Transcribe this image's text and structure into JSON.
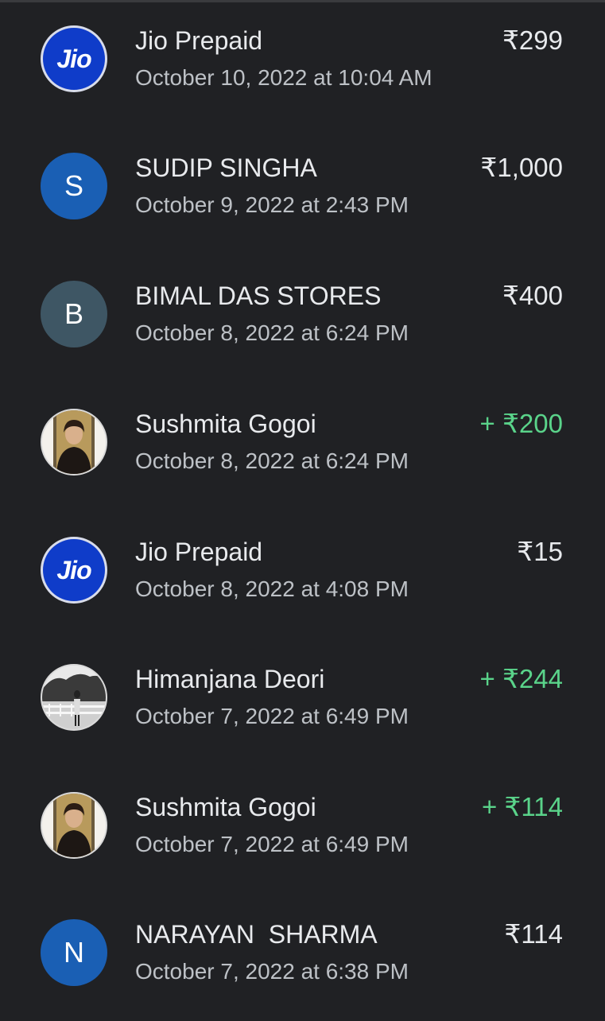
{
  "transactions": [
    {
      "name": "Jio Prepaid",
      "date": "October 10, 2022 at 10:04 AM",
      "amount": "₹299",
      "avatar": {
        "type": "logo",
        "label": "Jio"
      }
    },
    {
      "name": "SUDIP SINGHA",
      "date": "October 9, 2022 at 2:43 PM",
      "amount": "₹1,000",
      "avatar": {
        "type": "letter",
        "label": "S",
        "color": "#1a5fb4"
      }
    },
    {
      "name": "BIMAL DAS STORES",
      "date": "October 8, 2022 at 6:24 PM",
      "amount": "₹400",
      "avatar": {
        "type": "letter",
        "label": "B",
        "color": "#3e5664"
      }
    },
    {
      "name": "Sushmita Gogoi",
      "date": "October 8, 2022 at 6:24 PM",
      "amount": "+ ₹200",
      "avatar": {
        "type": "photo"
      }
    },
    {
      "name": "Jio Prepaid",
      "date": "October 8, 2022 at 4:08 PM",
      "amount": "₹15",
      "avatar": {
        "type": "logo",
        "label": "Jio"
      }
    },
    {
      "name": "Himanjana Deori",
      "date": "October 7, 2022 at 6:49 PM",
      "amount": "+ ₹244",
      "avatar": {
        "type": "photo"
      }
    },
    {
      "name": "Sushmita Gogoi",
      "date": "October 7, 2022 at 6:49 PM",
      "amount": "+ ₹114",
      "avatar": {
        "type": "photo"
      }
    },
    {
      "name": "NARAYAN  SHARMA",
      "date": "October 7, 2022 at 6:38 PM",
      "amount": "₹114",
      "avatar": {
        "type": "letter",
        "label": "N",
        "color": "#1a5fb4"
      }
    }
  ],
  "colors": {
    "background": "#202124",
    "primary_text": "#e8eaed",
    "secondary_text": "#bdc1c6",
    "credit_amount": "#5ad38a",
    "jio_blue": "#0f3cc9"
  }
}
